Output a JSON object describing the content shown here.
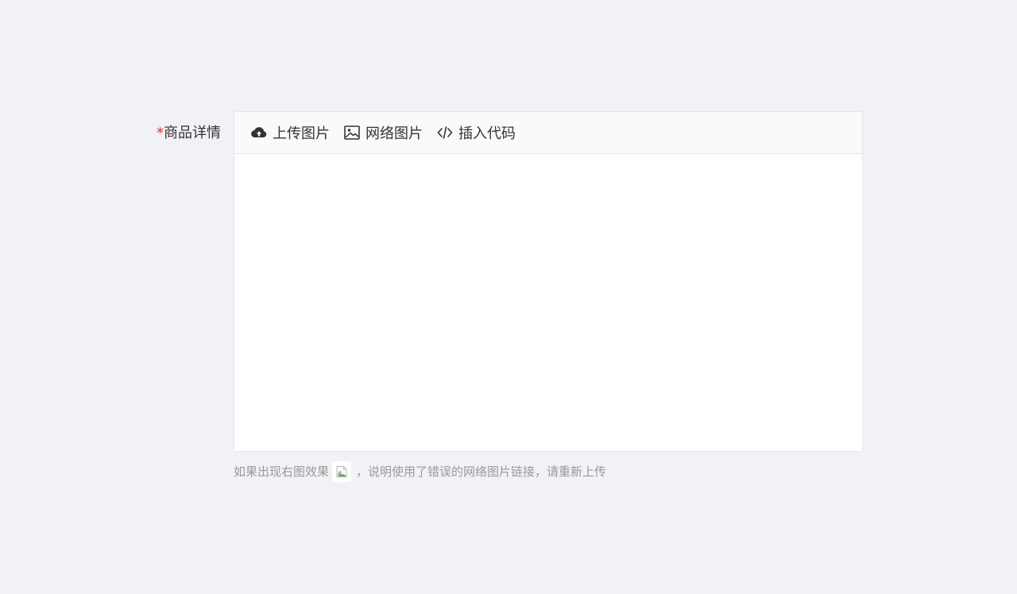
{
  "field": {
    "required_mark": "*",
    "label": "商品详情"
  },
  "toolbar": {
    "items": [
      {
        "label": "上传图片",
        "icon": "cloud-upload-icon"
      },
      {
        "label": "网络图片",
        "icon": "image-icon"
      },
      {
        "label": "插入代码",
        "icon": "code-icon"
      }
    ]
  },
  "editor": {
    "content": ""
  },
  "hint": {
    "before": "如果出现右图效果",
    "after": "，说明使用了错误的网络图片链接，请重新上传",
    "example_icon": "broken-image-icon"
  },
  "colors": {
    "background": "#f0f2f5",
    "required": "#f5222d",
    "text": "#333333",
    "hint": "#999999",
    "toolbar_bg": "#fafafa",
    "border": "#e4e6ea"
  }
}
